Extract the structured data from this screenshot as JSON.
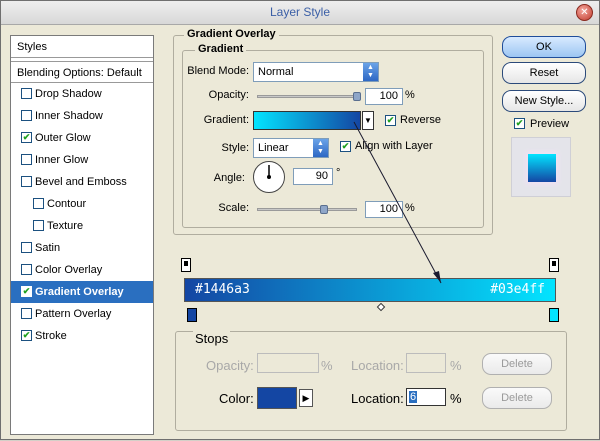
{
  "window": {
    "title": "Layer Style"
  },
  "sidebar": {
    "header": "Styles",
    "blending": "Blending Options: Default",
    "items": [
      {
        "label": "Drop Shadow",
        "checked": false
      },
      {
        "label": "Inner Shadow",
        "checked": false
      },
      {
        "label": "Outer Glow",
        "checked": true
      },
      {
        "label": "Inner Glow",
        "checked": false
      },
      {
        "label": "Bevel and Emboss",
        "checked": false
      },
      {
        "label": "Contour",
        "checked": false
      },
      {
        "label": "Texture",
        "checked": false
      },
      {
        "label": "Satin",
        "checked": false
      },
      {
        "label": "Color Overlay",
        "checked": false
      },
      {
        "label": "Gradient Overlay",
        "checked": true
      },
      {
        "label": "Pattern Overlay",
        "checked": false
      },
      {
        "label": "Stroke",
        "checked": true
      }
    ]
  },
  "overlay": {
    "group_title": "Gradient Overlay",
    "sub_title": "Gradient",
    "blend_mode_label": "Blend Mode:",
    "blend_mode_value": "Normal",
    "opacity_label": "Opacity:",
    "opacity_value": 100,
    "opacity_text": "100",
    "percent": "%",
    "gradient_label": "Gradient:",
    "reverse_label": "Reverse",
    "reverse_checked": true,
    "style_label": "Style:",
    "style_value": "Linear",
    "align_label": "Align with Layer",
    "align_checked": true,
    "angle_label": "Angle:",
    "angle_value": "90",
    "degree": "°",
    "scale_label": "Scale:",
    "scale_value": 100,
    "scale_text": "100"
  },
  "buttons": {
    "ok": "OK",
    "reset": "Reset",
    "new_style": "New Style...",
    "preview": "Preview",
    "preview_checked": true
  },
  "gradient_editor": {
    "left_hex": "#1446a3",
    "right_hex": "#03e4ff",
    "left_color": "#1446a3",
    "right_color": "#03e4ff"
  },
  "stops": {
    "title": "Stops",
    "opacity_label": "Opacity:",
    "opacity_location_label": "Location:",
    "percent": "%",
    "delete_label": "Delete",
    "color_label": "Color:",
    "color_location_label": "Location:",
    "color_location_value": "6",
    "color_delete_label": "Delete"
  },
  "colors": {
    "accent_selection": "#2a6fc0",
    "title_text": "#3b5fa6"
  }
}
